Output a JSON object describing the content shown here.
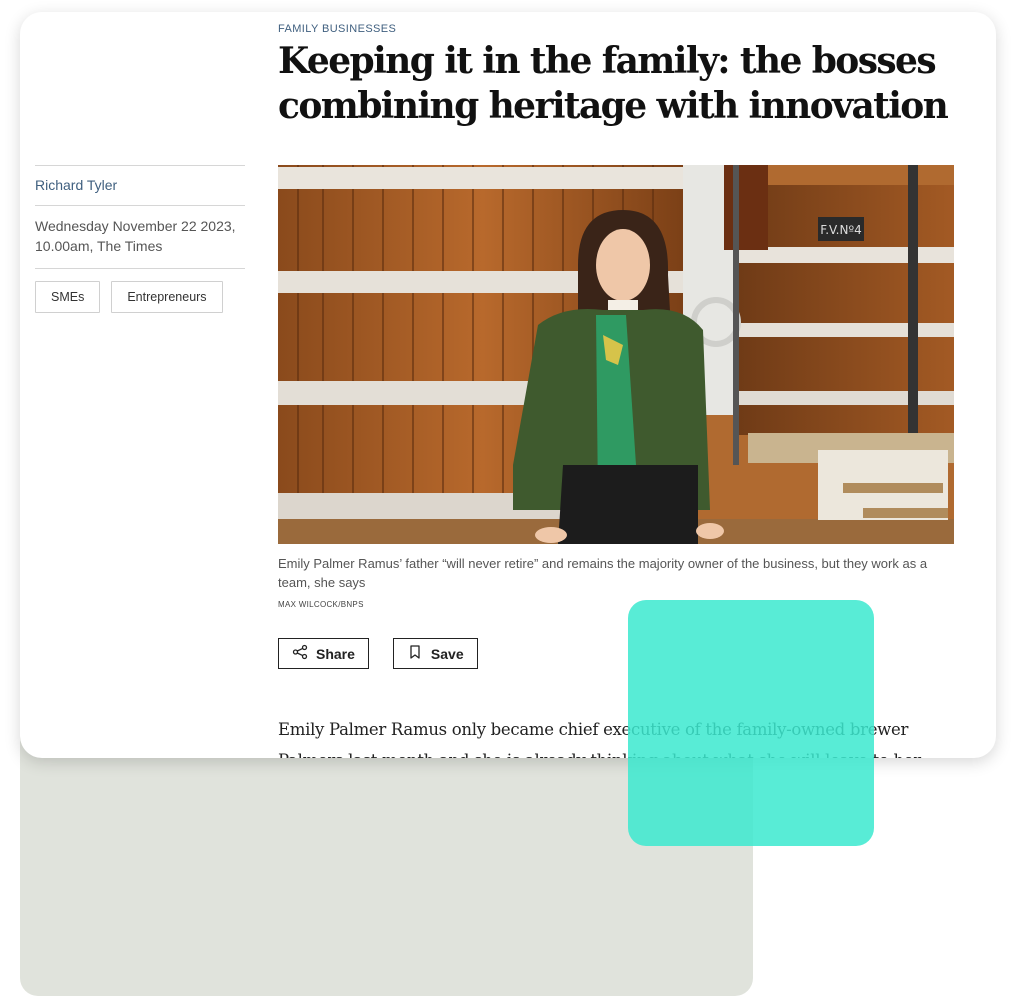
{
  "article": {
    "section": "FAMILY BUSINESSES",
    "headline": "Keeping it in the family: the bosses combining heritage with innovation",
    "author": "Richard Tyler",
    "dateline": "Wednesday November 22 2023, 10.00am, The Times",
    "tags": [
      "SMEs",
      "Entrepreneurs"
    ],
    "image_caption": "Emily Palmer Ramus’ father “will never retire” and remains the majority owner of the business, but they work as a team, she says",
    "image_credit": "MAX WILCOCK/BNPS",
    "vat_label": "F.V.Nº4",
    "actions": {
      "share_label": "Share",
      "save_label": "Save"
    },
    "body_first_paragraph": "Emily Palmer Ramus only became chief executive of the family-owned brewer Palmers last month and she is already thinking about what she will leave to her"
  },
  "colors": {
    "accent_blue": "#3f5f7f",
    "teal_overlay": "#3be9cf",
    "background_panel": "#e0e3dc"
  },
  "icons": [
    "share-icon",
    "bookmark-icon"
  ]
}
